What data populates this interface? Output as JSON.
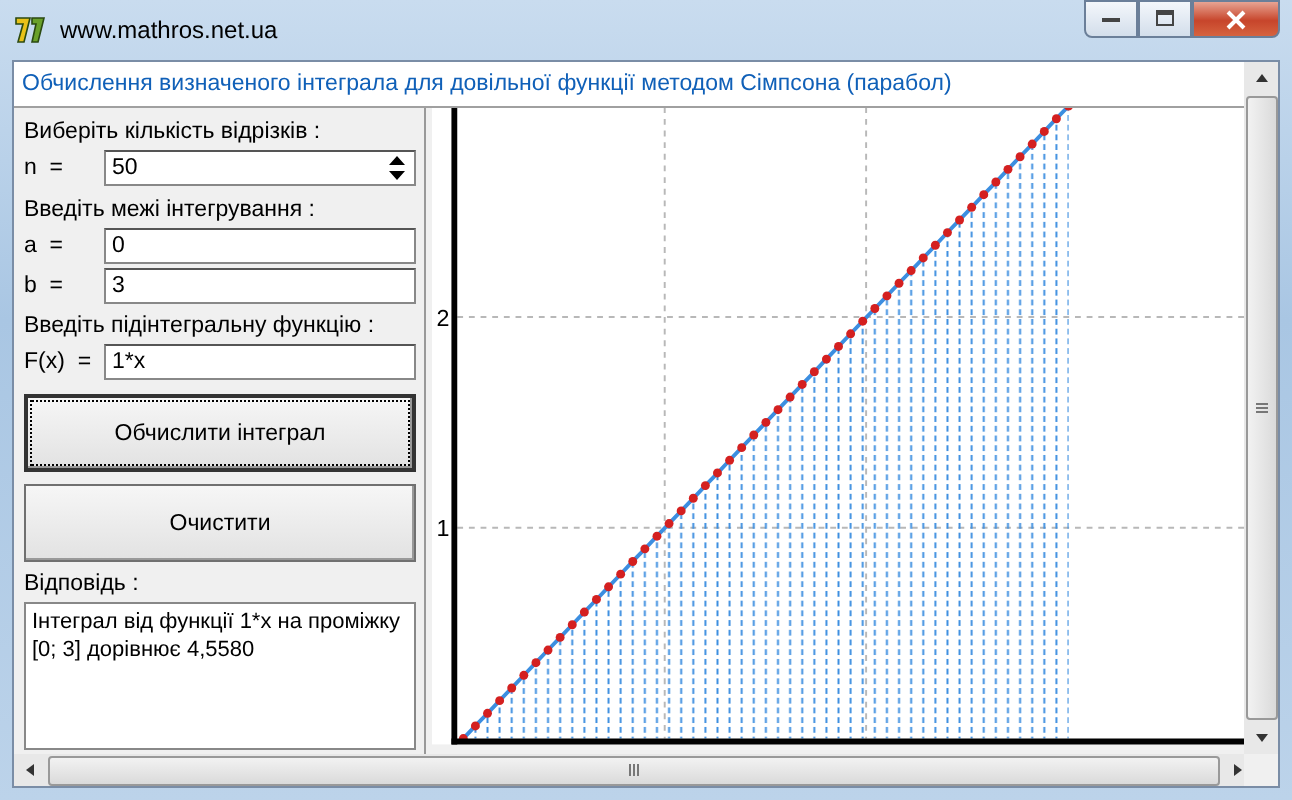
{
  "window": {
    "title": "www.mathros.net.ua"
  },
  "header": {
    "text": "Обчислення визначеного інтеграла для довільної функції методом Сімпсона (парабол)"
  },
  "form": {
    "segments": {
      "label": "Виберіть кількість відрізків :",
      "prefix": "n  =",
      "value": "50"
    },
    "limits_label": "Введіть межі інтегрування :",
    "limits": [
      {
        "prefix": "a  =",
        "value": "0"
      },
      {
        "prefix": "b  =",
        "value": "3"
      }
    ],
    "function_label": "Введіть підінтегральну функцію :",
    "function": {
      "prefix": "F(x)  =",
      "value": "1*x"
    }
  },
  "buttons": [
    {
      "label": "Обчислити інтеграл",
      "focused": true
    },
    {
      "label": "Очистити",
      "focused": false
    }
  ],
  "answer": {
    "label": "Відповідь :",
    "text": "Інтеграл від функції 1*x на проміжку [0; 3] дорівнює 4,5580"
  },
  "chart": {
    "chart_data": {
      "type": "area",
      "ylim": [
        0,
        3.05
      ],
      "yticks": [
        1,
        2
      ],
      "grid": true,
      "categories": [
        null,
        null,
        null,
        null,
        null,
        null,
        null,
        null,
        null,
        null,
        null,
        null,
        null,
        null,
        null,
        null,
        null,
        null,
        null,
        null,
        null,
        null,
        null,
        null,
        null,
        null,
        null,
        null,
        null,
        null,
        null,
        null,
        null,
        null,
        null,
        null,
        null,
        null,
        null,
        null,
        null,
        null,
        null,
        null,
        null,
        null,
        null,
        null,
        null,
        null,
        null,
        null,
        null,
        null,
        null,
        null,
        null,
        null,
        null,
        null,
        null,
        null,
        null,
        null,
        null
      ],
      "series": [
        {
          "color": "#3c8ee0",
          "marker": true,
          "values": [
            0,
            0.06,
            0.12,
            0.18,
            0.24,
            0.3,
            0.36,
            0.42,
            0.48,
            0.54,
            0.6,
            0.66,
            0.72,
            0.78,
            0.84,
            0.9,
            0.96,
            1.02,
            1.08,
            1.14,
            1.2,
            1.26,
            1.32,
            1.38,
            1.44,
            1.5,
            1.56,
            1.62,
            1.68,
            1.74,
            1.8,
            1.86,
            1.92,
            1.98,
            2.04,
            2.1,
            2.16,
            2.22,
            2.28,
            2.34,
            2.4,
            2.46,
            2.52,
            2.58,
            2.64,
            2.7,
            2.76,
            2.82,
            2.88,
            2.94,
            3,
            null,
            null,
            null,
            null,
            null,
            null,
            null,
            null,
            null,
            null,
            null,
            null,
            null,
            null
          ]
        }
      ]
    }
  }
}
